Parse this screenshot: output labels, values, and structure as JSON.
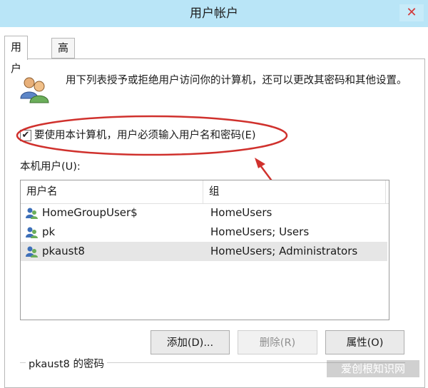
{
  "window": {
    "title": "用户帐户",
    "close_glyph": "✕"
  },
  "tabs": [
    {
      "label": "用户",
      "active": true
    },
    {
      "label": "高级",
      "active": false
    }
  ],
  "description": "用下列表授予或拒绝用户访问你的计算机，还可以更改其密码和其他设置。",
  "require_login": {
    "label": "要使用本计算机，用户必须输入用户名和密码(E)",
    "checked": true,
    "check_glyph": "✔"
  },
  "local_users_label": "本机用户(U):",
  "table": {
    "headers": [
      "用户名",
      "组"
    ],
    "rows": [
      {
        "name": "HomeGroupUser$",
        "group": "HomeUsers",
        "icon": "user-icon",
        "selected": false
      },
      {
        "name": "pk",
        "group": "HomeUsers; Users",
        "icon": "user-icon",
        "selected": false
      },
      {
        "name": "pkaust8",
        "group": "HomeUsers; Administrators",
        "icon": "user-icon",
        "selected": true
      }
    ]
  },
  "buttons": {
    "add": "添加(D)...",
    "remove": "删除(R)",
    "properties": "属性(O)"
  },
  "password_section_label": "pkaust8 的密码",
  "watermark": "爱创根知识网",
  "colors": {
    "titlebar": "#b9e5f7",
    "annotation": "#d0312d",
    "selected_row": "#e6e6e6"
  },
  "icons": {
    "users": "users-icon",
    "close": "close-icon",
    "user": "user-icon"
  }
}
